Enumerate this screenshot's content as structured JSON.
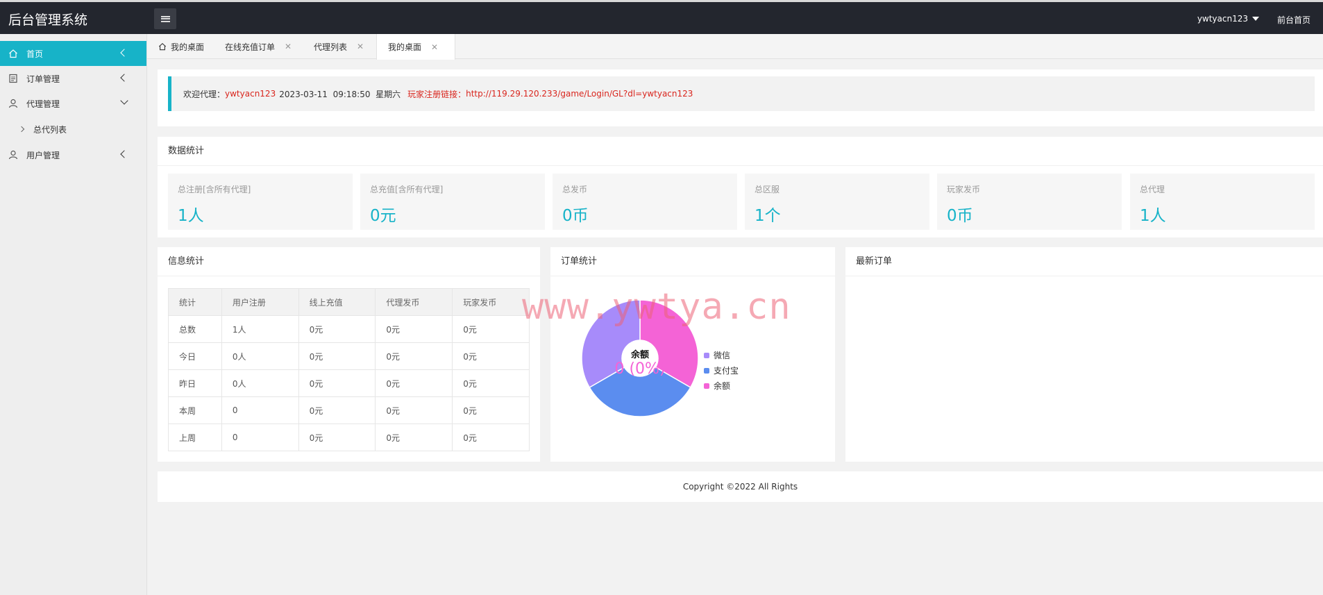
{
  "header": {
    "logo": "后台管理系统",
    "username": "ywtyacn123",
    "front_link": "前台首页"
  },
  "sidebar": {
    "items": [
      {
        "label": "首页",
        "icon": "home-icon"
      },
      {
        "label": "订单管理",
        "icon": "document-icon"
      },
      {
        "label": "代理管理",
        "icon": "user-icon"
      },
      {
        "label": "用户管理",
        "icon": "user-icon"
      }
    ],
    "sub_items": [
      {
        "label": "总代列表"
      }
    ]
  },
  "tabs": [
    {
      "label": "我的桌面"
    },
    {
      "label": "在线充值订单"
    },
    {
      "label": "代理列表"
    },
    {
      "label": "我的桌面"
    }
  ],
  "welcome": {
    "prefix": "欢迎代理：",
    "agent": "ywtyacn123",
    "datetime": "2023-03-11  09:18:50  星期六",
    "link_label": "玩家注册链接：",
    "link_url": "http://119.29.120.233/game/Login/GL?dl=ywtyacn123"
  },
  "data_stats": {
    "title": "数据统计",
    "boxes": [
      {
        "label": "总注册[含所有代理]",
        "value": "1人"
      },
      {
        "label": "总充值[含所有代理]",
        "value": "0元"
      },
      {
        "label": "总发币",
        "value": "0币"
      },
      {
        "label": "总区服",
        "value": "1个"
      },
      {
        "label": "玩家发币",
        "value": "0币"
      },
      {
        "label": "总代理",
        "value": "1人"
      }
    ]
  },
  "info_stats": {
    "title": "信息统计",
    "headers": [
      "统计",
      "用户注册",
      "线上充值",
      "代理发币",
      "玩家发币"
    ],
    "rows": [
      [
        "总数",
        "1人",
        "0元",
        "0元",
        "0元"
      ],
      [
        "今日",
        "0人",
        "0元",
        "0元",
        "0元"
      ],
      [
        "昨日",
        "0人",
        "0元",
        "0元",
        "0元"
      ],
      [
        "本周",
        "0",
        "0元",
        "0元",
        "0元"
      ],
      [
        "上周",
        "0",
        "0元",
        "0元",
        "0元"
      ]
    ]
  },
  "order_stats": {
    "title": "订单统计",
    "center_label": "余额",
    "center_value": "0 (0%)"
  },
  "latest_orders": {
    "title": "最新订单"
  },
  "chart_data": {
    "type": "pie",
    "categories": [
      "微信",
      "支付宝",
      "余额"
    ],
    "values": [
      1,
      1,
      1
    ],
    "colors": [
      "#a78bfa",
      "#5b8def",
      "#f463d6"
    ],
    "legend": "right"
  },
  "watermark": "www.ywtya.cn",
  "footer": "Copyright ©2022 All Rights"
}
